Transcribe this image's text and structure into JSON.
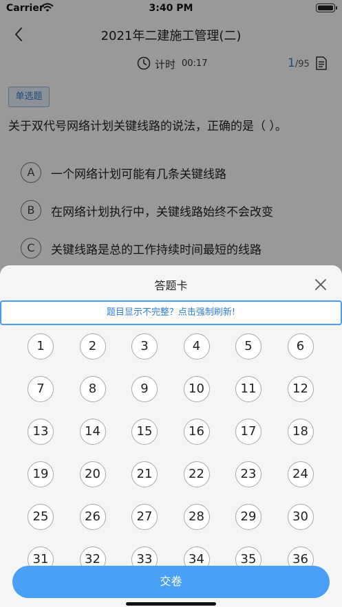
{
  "status_bar": {
    "carrier": "Carrier",
    "time": "3:40 PM"
  },
  "nav": {
    "title": "2021年二建施工管理(二)"
  },
  "sub_bar": {
    "timer_label": "计时",
    "timer_value": "00:17",
    "current": "1",
    "total": "/95"
  },
  "question": {
    "type": "单选题",
    "text": "关于双代号网络计划关键线路的说法，正确的是（ ）。",
    "options": [
      {
        "letter": "A",
        "text": "一个网络计划可能有几条关键线路"
      },
      {
        "letter": "B",
        "text": "在网络计划执行中，关键线路始终不会改变"
      },
      {
        "letter": "C",
        "text": "关键线路是总的工作持续时间最短的线路"
      }
    ]
  },
  "answer_sheet": {
    "title": "答题卡",
    "refresh_text": "题目显示不完整？点击强制刷新!",
    "numbers": [
      "1",
      "2",
      "3",
      "4",
      "5",
      "6",
      "7",
      "8",
      "9",
      "10",
      "11",
      "12",
      "13",
      "14",
      "15",
      "16",
      "17",
      "18",
      "19",
      "20",
      "21",
      "22",
      "23",
      "24",
      "25",
      "26",
      "27",
      "28",
      "29",
      "30",
      "31",
      "32",
      "33",
      "34",
      "35",
      "36"
    ],
    "submit_label": "交卷"
  }
}
